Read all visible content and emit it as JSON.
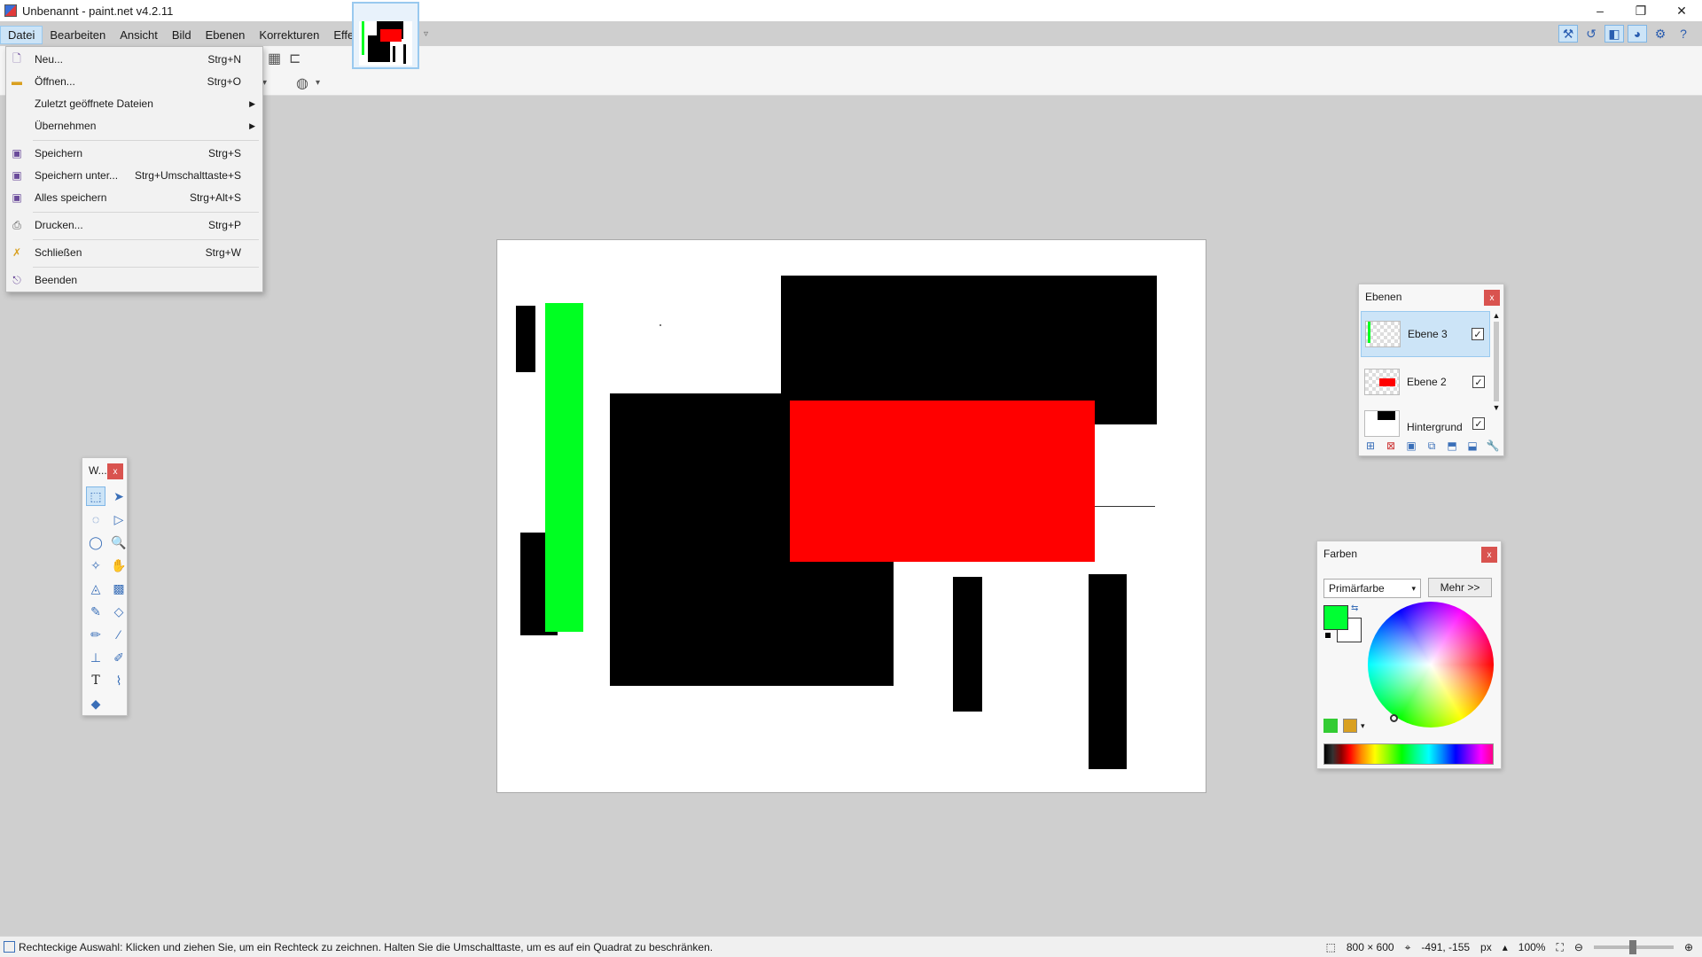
{
  "window": {
    "title": "Unbenannt - paint.net v4.2.11",
    "minimize": "–",
    "maximize": "❐",
    "close": "✕"
  },
  "menu": {
    "items": [
      "Datei",
      "Bearbeiten",
      "Ansicht",
      "Bild",
      "Ebenen",
      "Korrekturen",
      "Effekte"
    ]
  },
  "file_menu": {
    "items": [
      {
        "label": "Neu...",
        "shortcut": "Strg+N",
        "icon": "new-file-icon"
      },
      {
        "label": "Öffnen...",
        "shortcut": "Strg+O",
        "icon": "open-folder-icon"
      },
      {
        "label": "Zuletzt geöffnete Dateien",
        "shortcut": "",
        "submenu": true
      },
      {
        "label": "Übernehmen",
        "shortcut": "",
        "submenu": true
      },
      {
        "label": "Speichern",
        "shortcut": "Strg+S",
        "icon": "save-icon"
      },
      {
        "label": "Speichern unter...",
        "shortcut": "Strg+Umschalttaste+S",
        "icon": "save-as-icon"
      },
      {
        "label": "Alles speichern",
        "shortcut": "Strg+Alt+S",
        "icon": "save-all-icon"
      },
      {
        "label": "Drucken...",
        "shortcut": "Strg+P",
        "icon": "print-icon"
      },
      {
        "label": "Schließen",
        "shortcut": "Strg+W",
        "icon": "close-doc-icon"
      },
      {
        "label": "Beenden",
        "shortcut": "",
        "icon": "exit-icon"
      }
    ]
  },
  "tools_panel": {
    "title": "W...",
    "close": "x"
  },
  "layers_panel": {
    "title": "Ebenen",
    "close": "x",
    "layers": [
      {
        "name": "Ebene 3",
        "visible": true
      },
      {
        "name": "Ebene 2",
        "visible": true
      },
      {
        "name": "Hintergrund",
        "visible": true
      }
    ]
  },
  "colors_panel": {
    "title": "Farben",
    "close": "x",
    "mode": "Primärfarbe",
    "more": "Mehr >>",
    "primary_color": "#00ff33",
    "secondary_color": "#ffffff"
  },
  "status": {
    "hint": "Rechteckige Auswahl: Klicken und ziehen Sie, um ein Rechteck zu zeichnen. Halten Sie die Umschalttaste, um es auf ein Quadrat zu beschränken.",
    "size": "800 × 600",
    "cursor": "-491, -155",
    "unit": "px",
    "zoom": "100%"
  },
  "colors": {
    "accent": "#cce4f7",
    "green": "#00ff22",
    "red": "#ff0000",
    "black": "#000000"
  }
}
